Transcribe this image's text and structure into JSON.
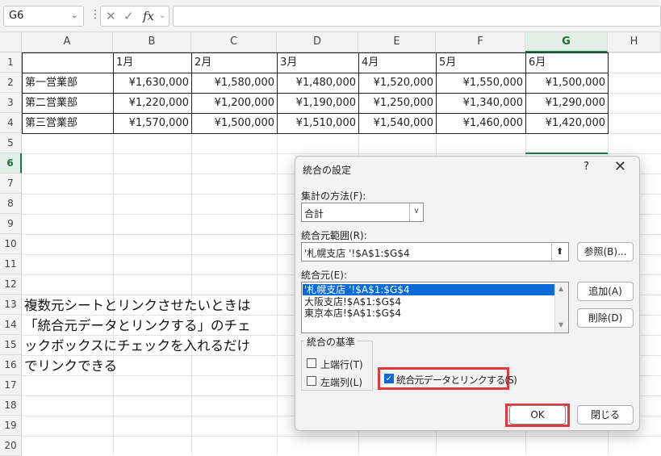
{
  "formula_bar": {
    "name_box": "G6",
    "formula": ""
  },
  "columns": [
    "A",
    "B",
    "C",
    "D",
    "E",
    "F",
    "G",
    "H"
  ],
  "rows": [
    "1",
    "2",
    "3",
    "4",
    "5",
    "6",
    "7",
    "8",
    "9",
    "10",
    "11",
    "12",
    "13",
    "14",
    "15",
    "16",
    "17",
    "18",
    "19",
    "20"
  ],
  "table": {
    "headers": [
      "",
      "1月",
      "2月",
      "3月",
      "4月",
      "5月",
      "6月"
    ],
    "body": [
      [
        "第一営業部",
        "¥1,630,000",
        "¥1,580,000",
        "¥1,480,000",
        "¥1,520,000",
        "¥1,550,000",
        "¥1,500,000"
      ],
      [
        "第二営業部",
        "¥1,220,000",
        "¥1,200,000",
        "¥1,190,000",
        "¥1,250,000",
        "¥1,340,000",
        "¥1,290,000"
      ],
      [
        "第三営業部",
        "¥1,570,000",
        "¥1,500,000",
        "¥1,510,000",
        "¥1,540,000",
        "¥1,460,000",
        "¥1,420,000"
      ]
    ]
  },
  "note": {
    "line1": "複数元シートとリンクさせたいときは",
    "line2": "「統合元データとリンクする」のチェ",
    "line3": "ックボックスにチェックを入れるだけ",
    "line4": "でリンクできる"
  },
  "dialog": {
    "title": "統合の設定",
    "help": "?",
    "close": "✕",
    "function_label": "集計の方法(F):",
    "function_value": "合計",
    "reference_label": "統合元範囲(R):",
    "reference_value": "'札幌支店 '!$A$1:$G$4",
    "browse_button": "参照(B)...",
    "all_refs_label": "統合元(E):",
    "all_refs": [
      "'札幌支店 '!$A$1:$G$4",
      "大阪支店!$A$1:$G$4",
      "東京本店!$A$1:$G$4"
    ],
    "add_button": "追加(A)",
    "delete_button": "削除(D)",
    "use_labels_group": "統合の基準",
    "top_row_label": "上端行(T)",
    "left_column_label": "左端列(L)",
    "link_label": "統合元データとリンクする(S)",
    "ok_button": "OK",
    "close_button": "閉じる"
  },
  "colors": {
    "selected_green": "#1e7b45",
    "highlight_red": "#e0393e",
    "list_selection": "#0a6ad6"
  }
}
